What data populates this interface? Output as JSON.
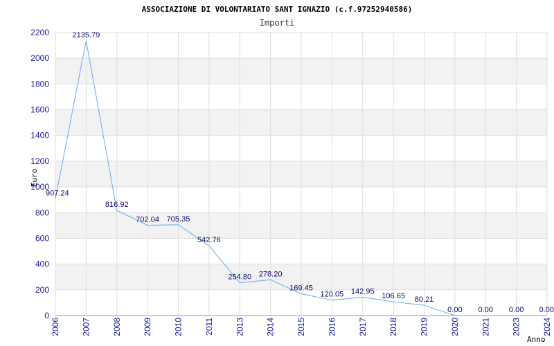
{
  "chart_data": {
    "type": "line",
    "title": "ASSOCIAZIONE DI VOLONTARIATO SANT IGNAZIO (c.f.97252940586)",
    "subtitle": "Importi",
    "xlabel": "Anno",
    "ylabel": "Euro",
    "ylim": [
      0,
      2200
    ],
    "yticks": [
      "0",
      "200",
      "400",
      "600",
      "800",
      "1000",
      "1200",
      "1400",
      "1600",
      "1800",
      "2000",
      "2200"
    ],
    "grid": true,
    "categories": [
      "2006",
      "2007",
      "2008",
      "2009",
      "2010",
      "2011",
      "2013",
      "2014",
      "2015",
      "2016",
      "2017",
      "2018",
      "2019",
      "2020",
      "2021",
      "2023",
      "2024"
    ],
    "series": [
      {
        "values": [
          907.24,
          2135.79,
          816.92,
          702.04,
          705.35,
          542.76,
          254.8,
          278.2,
          169.45,
          120.05,
          142.95,
          106.65,
          80.21,
          0.0,
          0.0,
          0.0,
          0.0
        ],
        "labels": [
          "907.24",
          "2135.79",
          "816.92",
          "702.04",
          "705.35",
          "542.76",
          "254.80",
          "278.20",
          "169.45",
          "120.05",
          "142.95",
          "106.65",
          "80.21",
          "0.00",
          "0.00",
          "0.00",
          "0.00"
        ]
      }
    ],
    "colors": {
      "line": "#66aaee",
      "band": "#f2f2f2",
      "grid": "#dddddd",
      "tick_text": "#1a1aa6",
      "label_text": "#0a0a6e"
    }
  }
}
